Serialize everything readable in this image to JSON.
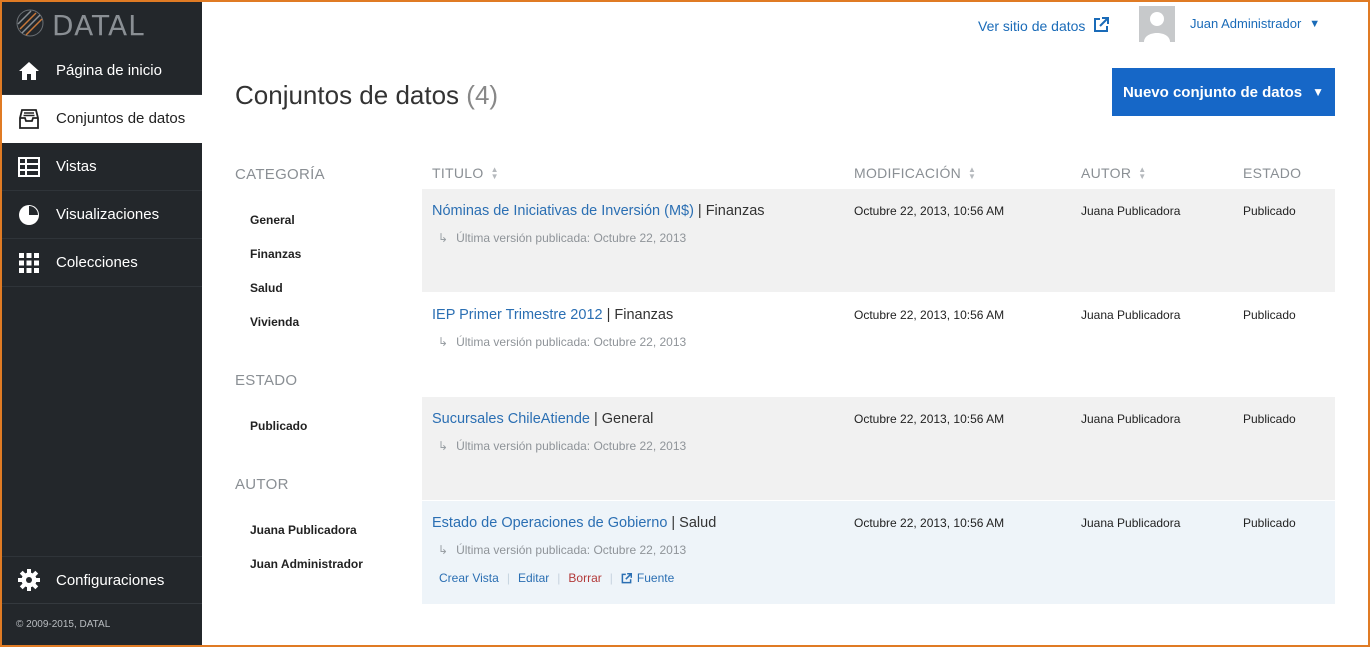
{
  "colors": {
    "sidebar_bg": "#23272b",
    "accent_blue": "#1667c7",
    "link_blue": "#2b6fb3",
    "delete_red": "#b33a3a",
    "frame_orange": "#e07b24"
  },
  "app": {
    "logo_text": "DATAL",
    "copyright": "© 2009-2015, DATAL"
  },
  "sidebar": {
    "items": [
      {
        "label": "Página de inicio",
        "icon": "home-icon"
      },
      {
        "label": "Conjuntos de datos",
        "icon": "dataset-tray-icon",
        "active": true
      },
      {
        "label": "Vistas",
        "icon": "table-icon"
      },
      {
        "label": "Visualizaciones",
        "icon": "pie-chart-icon"
      },
      {
        "label": "Colecciones",
        "icon": "grid-icon"
      }
    ],
    "settings": {
      "label": "Configuraciones",
      "icon": "gear-icon"
    }
  },
  "header": {
    "view_site_label": "Ver sitio de datos",
    "user_name": "Juan Administrador"
  },
  "main": {
    "title": "Conjuntos de datos",
    "count": "(4)",
    "new_button_label": "Nuevo conjunto de datos"
  },
  "filters": {
    "category": {
      "heading": "CATEGORÍA",
      "items": [
        "General",
        "Finanzas",
        "Salud",
        "Vivienda"
      ]
    },
    "status": {
      "heading": "ESTADO",
      "items": [
        "Publicado"
      ]
    },
    "author": {
      "heading": "AUTOR",
      "items": [
        "Juana Publicadora",
        "Juan Administrador"
      ]
    }
  },
  "table": {
    "columns": [
      "TITULO",
      "MODIFICACIÓN",
      "AUTOR",
      "ESTADO"
    ],
    "rows": [
      {
        "title": "Nóminas de Iniciativas de Inversión (M$)",
        "category": "Finanzas",
        "subtitle": "Última versión publicada: Octubre 22, 2013",
        "modified": "Octubre 22, 2013, 10:56 AM",
        "author": "Juana Publicadora",
        "status": "Publicado"
      },
      {
        "title": "IEP Primer Trimestre 2012",
        "category": "Finanzas",
        "subtitle": "Última versión publicada: Octubre 22, 2013",
        "modified": "Octubre 22, 2013, 10:56 AM",
        "author": "Juana Publicadora",
        "status": "Publicado"
      },
      {
        "title": "Sucursales ChileAtiende",
        "category": "General",
        "subtitle": "Última versión publicada: Octubre 22, 2013",
        "modified": "Octubre 22, 2013, 10:56 AM",
        "author": "Juana Publicadora",
        "status": "Publicado"
      },
      {
        "title": "Estado de Operaciones de Gobierno",
        "category": "Salud",
        "subtitle": "Última versión publicada: Octubre 22, 2013",
        "modified": "Octubre 22, 2013, 10:56 AM",
        "author": "Juana Publicadora",
        "status": "Publicado"
      }
    ],
    "row_actions": {
      "create_view": "Crear Vista",
      "edit": "Editar",
      "delete": "Borrar",
      "source": "Fuente"
    }
  }
}
